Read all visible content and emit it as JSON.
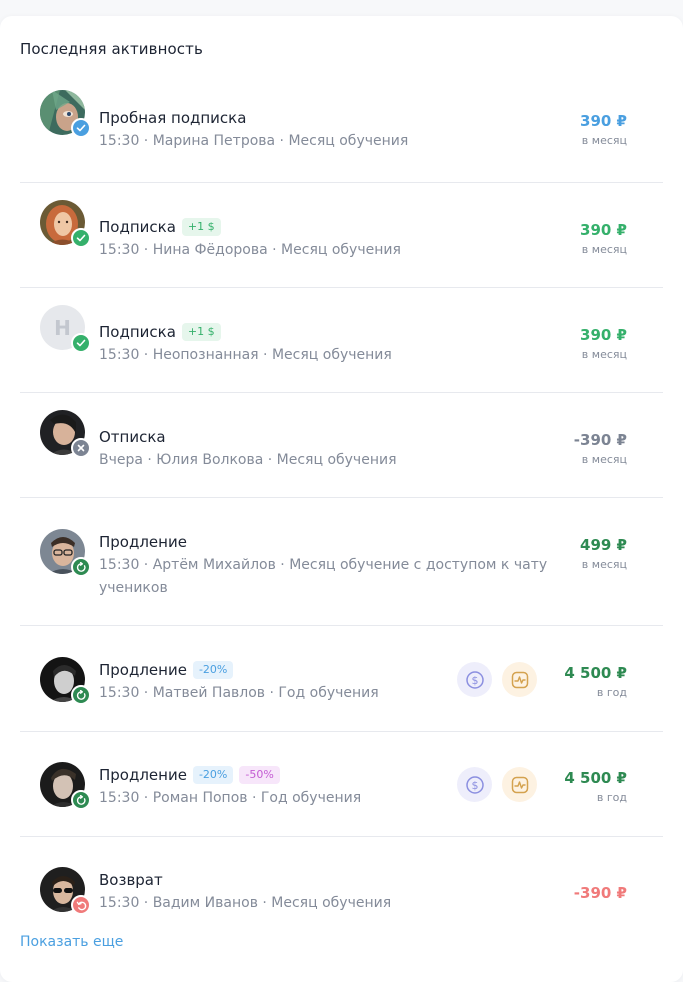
{
  "title": "Последняя активность",
  "colors": {
    "blue": "#4a9fe0",
    "green": "#35b06b",
    "dark_green": "#2e8a52",
    "gray": "#7c8493",
    "red": "#f07a7a"
  },
  "items": [
    {
      "name": "Пробная подписка",
      "meta": "15:30 · Марина Петрова · Месяц обучения",
      "amount": "390 ₽",
      "period": "в месяц",
      "badge_icon": "check-icon"
    },
    {
      "name": "Подписка",
      "tags": [
        "+1 $"
      ],
      "meta": "15:30 · Нина Фёдорова · Месяц обучения",
      "amount": "390 ₽",
      "period": "в месяц",
      "badge_icon": "check-icon"
    },
    {
      "name": "Подписка",
      "tags": [
        "+1 $"
      ],
      "avatar_initial": "Н",
      "meta": "15:30 · Неопознанная · Месяц обучения",
      "amount": "390 ₽",
      "period": "в месяц",
      "badge_icon": "check-icon"
    },
    {
      "name": "Отписка",
      "meta": "Вчера · Юлия Волкова · Месяц обучения",
      "amount": "-390 ₽",
      "period": "в месяц",
      "badge_icon": "close-icon"
    },
    {
      "name": "Продление",
      "meta": "15:30 · Артём Михайлов · Месяц обучение с доступом к чату учеников",
      "amount": "499 ₽",
      "period": "в месяц",
      "badge_icon": "renew-icon"
    },
    {
      "name": "Продление",
      "tags": [
        "-20%"
      ],
      "meta": "15:30 · Матвей Павлов · Год обучения",
      "amount": "4 500 ₽",
      "period": "в год",
      "badge_icon": "renew-icon",
      "action_icons": [
        "dollar-icon",
        "pulse-icon"
      ]
    },
    {
      "name": "Продление",
      "tags": [
        "-20%",
        "-50%"
      ],
      "meta": "15:30 · Роман Попов · Год обучения",
      "amount": "4 500 ₽",
      "period": "в год",
      "badge_icon": "renew-icon",
      "action_icons": [
        "dollar-icon",
        "pulse-icon"
      ]
    },
    {
      "name": "Возврат",
      "meta": "15:30 · Вадим Иванов · Месяц обучения",
      "amount": "-390 ₽",
      "badge_icon": "undo-icon"
    }
  ],
  "show_more": "Показать еще"
}
